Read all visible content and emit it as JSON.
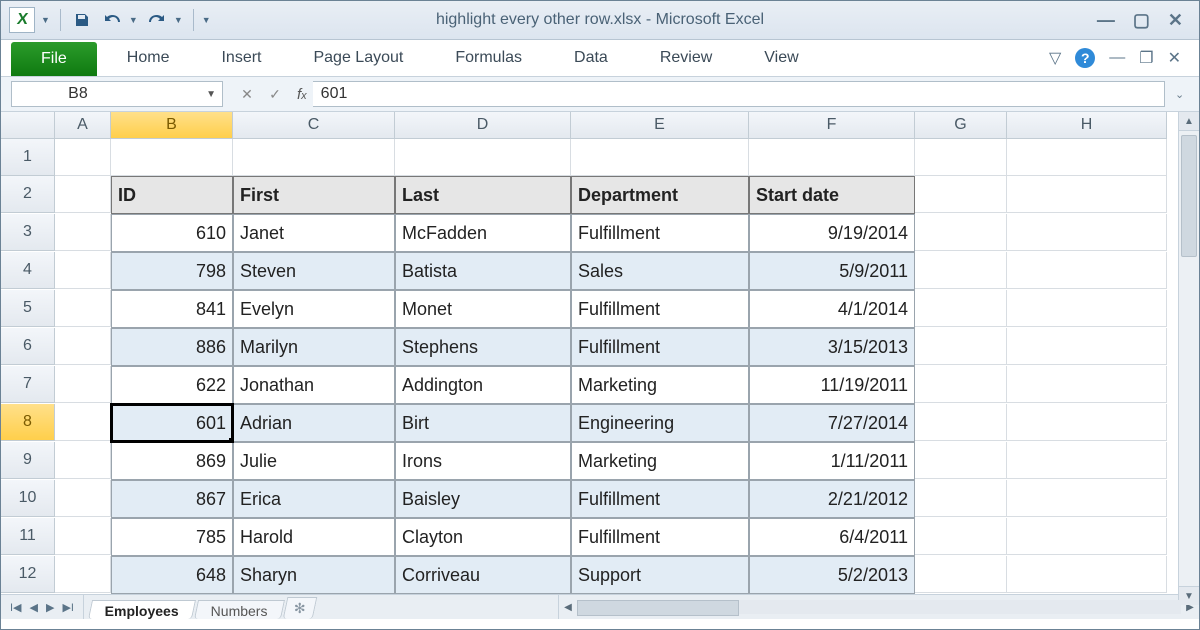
{
  "title": "highlight every other row.xlsx - Microsoft Excel",
  "ribbon": {
    "file": "File",
    "tabs": [
      "Home",
      "Insert",
      "Page Layout",
      "Formulas",
      "Data",
      "Review",
      "View"
    ]
  },
  "namebox": "B8",
  "formula": "601",
  "cols": [
    "A",
    "B",
    "C",
    "D",
    "E",
    "F",
    "G",
    "H"
  ],
  "selected_col": "B",
  "selected_row": 8,
  "row_start": 1,
  "row_end": 12,
  "headers": [
    "ID",
    "First",
    "Last",
    "Department",
    "Start date"
  ],
  "header_row": 2,
  "data": [
    {
      "id": 610,
      "first": "Janet",
      "last": "McFadden",
      "dept": "Fulfillment",
      "date": "9/19/2014"
    },
    {
      "id": 798,
      "first": "Steven",
      "last": "Batista",
      "dept": "Sales",
      "date": "5/9/2011"
    },
    {
      "id": 841,
      "first": "Evelyn",
      "last": "Monet",
      "dept": "Fulfillment",
      "date": "4/1/2014"
    },
    {
      "id": 886,
      "first": "Marilyn",
      "last": "Stephens",
      "dept": "Fulfillment",
      "date": "3/15/2013"
    },
    {
      "id": 622,
      "first": "Jonathan",
      "last": "Addington",
      "dept": "Marketing",
      "date": "11/19/2011"
    },
    {
      "id": 601,
      "first": "Adrian",
      "last": "Birt",
      "dept": "Engineering",
      "date": "7/27/2014"
    },
    {
      "id": 869,
      "first": "Julie",
      "last": "Irons",
      "dept": "Marketing",
      "date": "1/11/2011"
    },
    {
      "id": 867,
      "first": "Erica",
      "last": "Baisley",
      "dept": "Fulfillment",
      "date": "2/21/2012"
    },
    {
      "id": 785,
      "first": "Harold",
      "last": "Clayton",
      "dept": "Fulfillment",
      "date": "6/4/2011"
    },
    {
      "id": 648,
      "first": "Sharyn",
      "last": "Corriveau",
      "dept": "Support",
      "date": "5/2/2013"
    }
  ],
  "sheets": {
    "active": "Employees",
    "others": [
      "Numbers"
    ]
  }
}
